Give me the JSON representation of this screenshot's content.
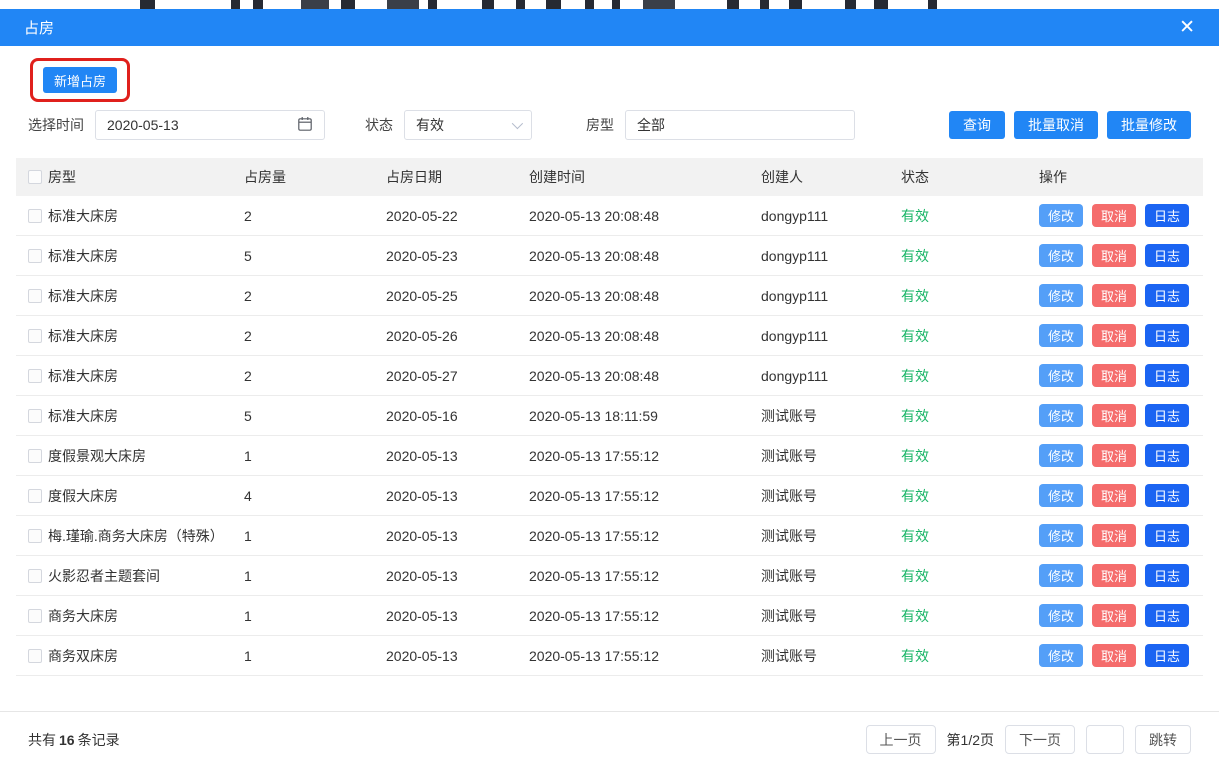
{
  "colors": {
    "primary_blue": "#2186f5",
    "status_green": "#18b566",
    "modify_blue": "#549ff8",
    "cancel_red": "#f56c6c",
    "log_blue": "#1b64f2",
    "annotation_red": "#e0201c",
    "header_gray": "#f2f2f2"
  },
  "modal": {
    "title": "占房",
    "close_icon": "✕"
  },
  "toolbar": {
    "add_button": "新增占房"
  },
  "filters": {
    "date_label": "选择时间",
    "date_value": "2020-05-13",
    "status_label": "状态",
    "status_value": "有效",
    "room_type_label": "房型",
    "room_type_value": "全部",
    "query_button": "查询",
    "batch_cancel_button": "批量取消",
    "batch_modify_button": "批量修改"
  },
  "table": {
    "headers": [
      "房型",
      "占房量",
      "占房日期",
      "创建时间",
      "创建人",
      "状态",
      "操作"
    ],
    "row_actions": [
      "修改",
      "取消",
      "日志"
    ],
    "rows": [
      {
        "room_type": "标准大床房",
        "count": "2",
        "date": "2020-05-22",
        "created": "2020-05-13 20:08:48",
        "creator": "dongyp111",
        "status": "有效"
      },
      {
        "room_type": "标准大床房",
        "count": "5",
        "date": "2020-05-23",
        "created": "2020-05-13 20:08:48",
        "creator": "dongyp111",
        "status": "有效"
      },
      {
        "room_type": "标准大床房",
        "count": "2",
        "date": "2020-05-25",
        "created": "2020-05-13 20:08:48",
        "creator": "dongyp111",
        "status": "有效"
      },
      {
        "room_type": "标准大床房",
        "count": "2",
        "date": "2020-05-26",
        "created": "2020-05-13 20:08:48",
        "creator": "dongyp111",
        "status": "有效"
      },
      {
        "room_type": "标准大床房",
        "count": "2",
        "date": "2020-05-27",
        "created": "2020-05-13 20:08:48",
        "creator": "dongyp111",
        "status": "有效"
      },
      {
        "room_type": "标准大床房",
        "count": "5",
        "date": "2020-05-16",
        "created": "2020-05-13 18:11:59",
        "creator": "测试账号",
        "status": "有效"
      },
      {
        "room_type": "度假景观大床房",
        "count": "1",
        "date": "2020-05-13",
        "created": "2020-05-13 17:55:12",
        "creator": "测试账号",
        "status": "有效"
      },
      {
        "room_type": "度假大床房",
        "count": "4",
        "date": "2020-05-13",
        "created": "2020-05-13 17:55:12",
        "creator": "测试账号",
        "status": "有效"
      },
      {
        "room_type": "梅.瑾瑜.商务大床房（特殊）",
        "count": "1",
        "date": "2020-05-13",
        "created": "2020-05-13 17:55:12",
        "creator": "测试账号",
        "status": "有效"
      },
      {
        "room_type": "火影忍者主题套间",
        "count": "1",
        "date": "2020-05-13",
        "created": "2020-05-13 17:55:12",
        "creator": "测试账号",
        "status": "有效"
      },
      {
        "room_type": "商务大床房",
        "count": "1",
        "date": "2020-05-13",
        "created": "2020-05-13 17:55:12",
        "creator": "测试账号",
        "status": "有效"
      },
      {
        "room_type": "商务双床房",
        "count": "1",
        "date": "2020-05-13",
        "created": "2020-05-13 17:55:12",
        "creator": "测试账号",
        "status": "有效"
      }
    ]
  },
  "footer": {
    "total_prefix": "共有",
    "total_count": "16",
    "total_suffix": "条记录",
    "prev_button": "上一页",
    "page_info": "第1/2页",
    "next_button": "下一页",
    "jump_button": "跳转"
  }
}
